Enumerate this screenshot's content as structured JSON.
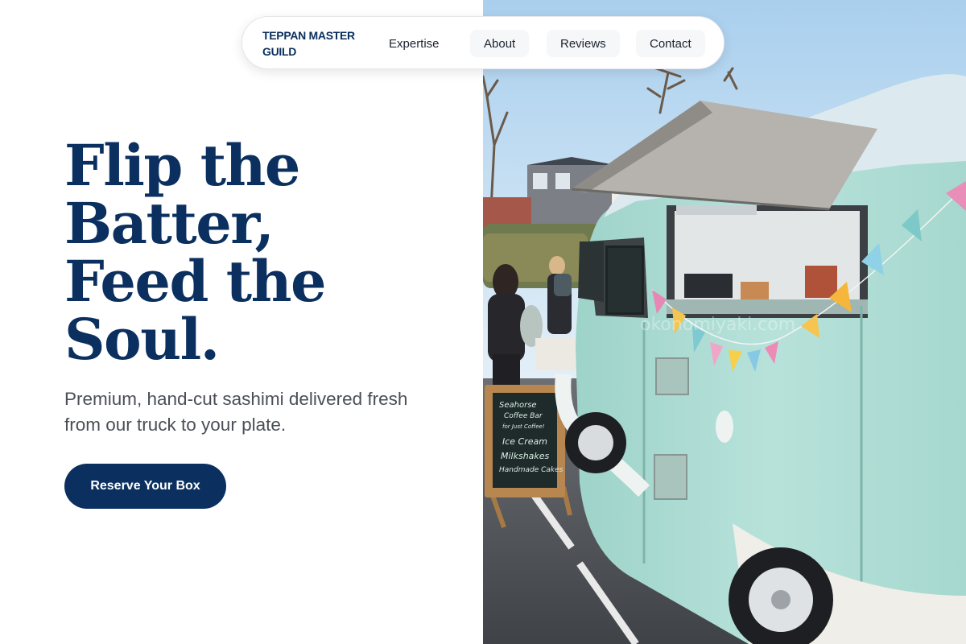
{
  "nav": {
    "brand": "TEPPAN MASTER GUILD",
    "links": [
      {
        "label": "Expertise"
      },
      {
        "label": "About"
      },
      {
        "label": "Reviews"
      },
      {
        "label": "Contact"
      }
    ]
  },
  "hero": {
    "headline_lines": [
      "Flip the",
      "Batter,",
      "Feed the",
      "Soul."
    ],
    "subtitle": "Premium, hand-cut sashimi delivered fresh from our truck to your plate.",
    "cta_label": "Reserve Your Box"
  },
  "photo": {
    "subject": "food-truck-photo",
    "chalkboard_lines": [
      "Seahorse",
      "Coffee Bar",
      "for Just Coffee!",
      "Ice Cream",
      "Milkshakes",
      "Handmade Cakes"
    ],
    "watermark": "okonomiyaki.com"
  },
  "colors": {
    "brand_navy": "#0b3060",
    "van_teal": "#a9dcd3",
    "sky": "#c7dff0"
  }
}
